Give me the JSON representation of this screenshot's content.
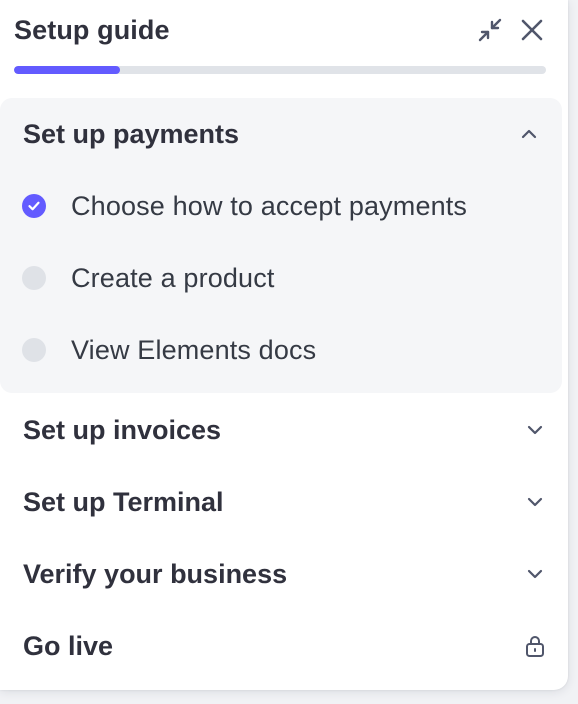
{
  "header": {
    "title": "Setup guide",
    "minimize_icon": "collapse-arrows-icon",
    "close_icon": "close-icon"
  },
  "progress": {
    "fraction": 0.2,
    "color": "#635bff"
  },
  "sections": [
    {
      "title": "Set up payments",
      "expanded": true,
      "toggle_icon": "chevron-up-icon",
      "tasks": [
        {
          "label": "Choose how to accept payments",
          "done": true
        },
        {
          "label": "Create a product",
          "done": false
        },
        {
          "label": "View Elements docs",
          "done": false
        }
      ]
    },
    {
      "title": "Set up invoices",
      "expanded": false,
      "toggle_icon": "chevron-down-icon"
    },
    {
      "title": "Set up Terminal",
      "expanded": false,
      "toggle_icon": "chevron-down-icon"
    },
    {
      "title": "Verify your business",
      "expanded": false,
      "toggle_icon": "chevron-down-icon"
    },
    {
      "title": "Go live",
      "expanded": false,
      "toggle_icon": "lock-icon"
    }
  ]
}
